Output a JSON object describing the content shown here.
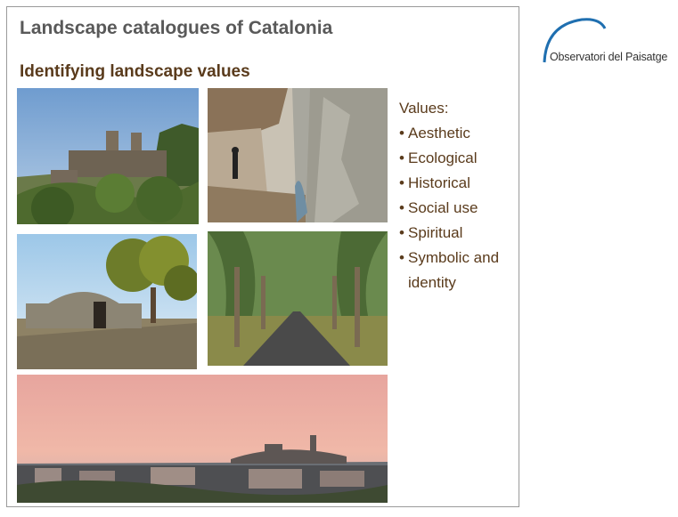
{
  "slide": {
    "title": "Landscape catalogues of Catalonia",
    "subtitle": "Identifying landscape values"
  },
  "values_panel": {
    "heading": "Values:",
    "items": [
      "Aesthetic",
      "Ecological",
      "Historical",
      "Social use",
      "Spiritual",
      "Symbolic and identity"
    ]
  },
  "logo": {
    "text": "Observatori del Paisatge",
    "color": "#1f6fb0"
  },
  "photos": [
    {
      "icon": "monastery-photo"
    },
    {
      "icon": "canyon-path-photo"
    },
    {
      "icon": "stone-hut-photo"
    },
    {
      "icon": "tree-lined-road-photo"
    },
    {
      "icon": "town-panorama-photo"
    }
  ]
}
